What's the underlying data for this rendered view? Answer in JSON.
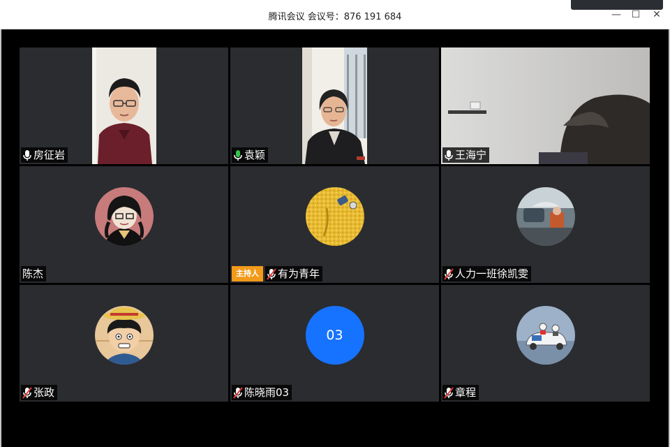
{
  "window": {
    "title": "腾讯会议 会议号：876 191 684",
    "minimize_icon": "—",
    "maximize_icon": "☐",
    "close_icon": "✕"
  },
  "host_badge_label": "主持人",
  "participants": [
    {
      "name": "房征岩",
      "mic": "on",
      "kind": "video"
    },
    {
      "name": "袁颖",
      "mic": "speaking",
      "kind": "video"
    },
    {
      "name": "王海宁",
      "mic": "on",
      "kind": "video"
    },
    {
      "name": "陈杰",
      "mic": "none",
      "kind": "avatar"
    },
    {
      "name": "有为青年",
      "mic": "muted",
      "kind": "avatar",
      "host": true
    },
    {
      "name": "人力一班徐凯雯",
      "mic": "muted",
      "kind": "avatar"
    },
    {
      "name": "张政",
      "mic": "muted",
      "kind": "avatar"
    },
    {
      "name": "陈晓雨03",
      "mic": "muted",
      "kind": "number-avatar",
      "avatar_text": "03"
    },
    {
      "name": "章程",
      "mic": "muted",
      "kind": "avatar"
    }
  ],
  "colors": {
    "tile_bg": "#2a2c30",
    "host_badge": "#f29a1a",
    "speaking_mic": "#35c24a",
    "muted_mic_slash": "#e53935",
    "number_avatar": "#1673ff"
  }
}
